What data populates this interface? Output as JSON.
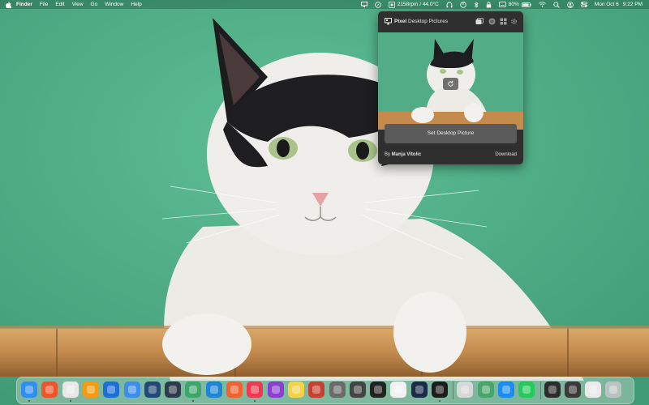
{
  "menubar": {
    "apple_icon": "apple-logo-icon",
    "menus": [
      "Finder",
      "File",
      "Edit",
      "View",
      "Go",
      "Window",
      "Help"
    ],
    "status": {
      "fan_reading": "2158rpm / 44.0°C",
      "battery_percent": "80%",
      "date": "Mon Oct 6",
      "time": "9:22 PM"
    }
  },
  "popover": {
    "title_bold": "Pixel",
    "title_rest": " Desktop Pictures",
    "set_button_label": "Set Desktop Picture",
    "credit_prefix": "By ",
    "author": "Manja Vitolic",
    "download_label": "Download"
  },
  "dock": {
    "apps": [
      {
        "name": "finder",
        "color": "#2f8ef0",
        "running": true
      },
      {
        "name": "brave",
        "color": "#f0542d",
        "running": false
      },
      {
        "name": "chrome",
        "color": "#e8e8e8",
        "running": true
      },
      {
        "name": "vlc",
        "color": "#f29b13",
        "running": false
      },
      {
        "name": "xcode",
        "color": "#1b6fd6",
        "running": false
      },
      {
        "name": "files",
        "color": "#3d8ee8",
        "running": false
      },
      {
        "name": "dropbox",
        "color": "#234a76",
        "running": false
      },
      {
        "name": "layers",
        "color": "#2e3b4e",
        "running": false
      },
      {
        "name": "maps",
        "color": "#3fa66a",
        "running": true
      },
      {
        "name": "vscode",
        "color": "#1f86d6",
        "running": false
      },
      {
        "name": "swift-playgrounds",
        "color": "#f2612f",
        "running": false
      },
      {
        "name": "music",
        "color": "#f0394f",
        "running": true
      },
      {
        "name": "notchmeister",
        "color": "#8b3fd0",
        "running": false
      },
      {
        "name": "notes",
        "color": "#f3d34a",
        "running": false
      },
      {
        "name": "compass",
        "color": "#c8402f",
        "running": false
      },
      {
        "name": "system-settings",
        "color": "#6b6b6b",
        "running": false
      },
      {
        "name": "screenshot",
        "color": "#444444",
        "running": false
      },
      {
        "name": "piano",
        "color": "#222222",
        "running": false
      },
      {
        "name": "preview",
        "color": "#f1f1f1",
        "running": false
      },
      {
        "name": "globe",
        "color": "#1c2b4a",
        "running": false
      },
      {
        "name": "terminal",
        "color": "#1d1d1d",
        "running": true
      },
      {
        "name": "printer",
        "color": "#d8d8d8",
        "running": false
      },
      {
        "name": "maps-alt",
        "color": "#4aa56b",
        "running": false
      },
      {
        "name": "app-store",
        "color": "#1c8cf2",
        "running": false
      },
      {
        "name": "whatsapp",
        "color": "#26c95b",
        "running": false
      },
      {
        "name": "recent-window-1",
        "color": "#2c2c2c",
        "running": false
      },
      {
        "name": "recent-window-2",
        "color": "#3a3a3a",
        "running": false
      },
      {
        "name": "recent-window-3",
        "color": "#eaeaea",
        "running": false
      },
      {
        "name": "trash",
        "color": "#b9c4c2",
        "running": false
      }
    ]
  },
  "colors": {
    "wallpaper_green": "#4fae86",
    "popover_bg": "#2f2f2f",
    "button_bg": "#5a5a5a"
  }
}
